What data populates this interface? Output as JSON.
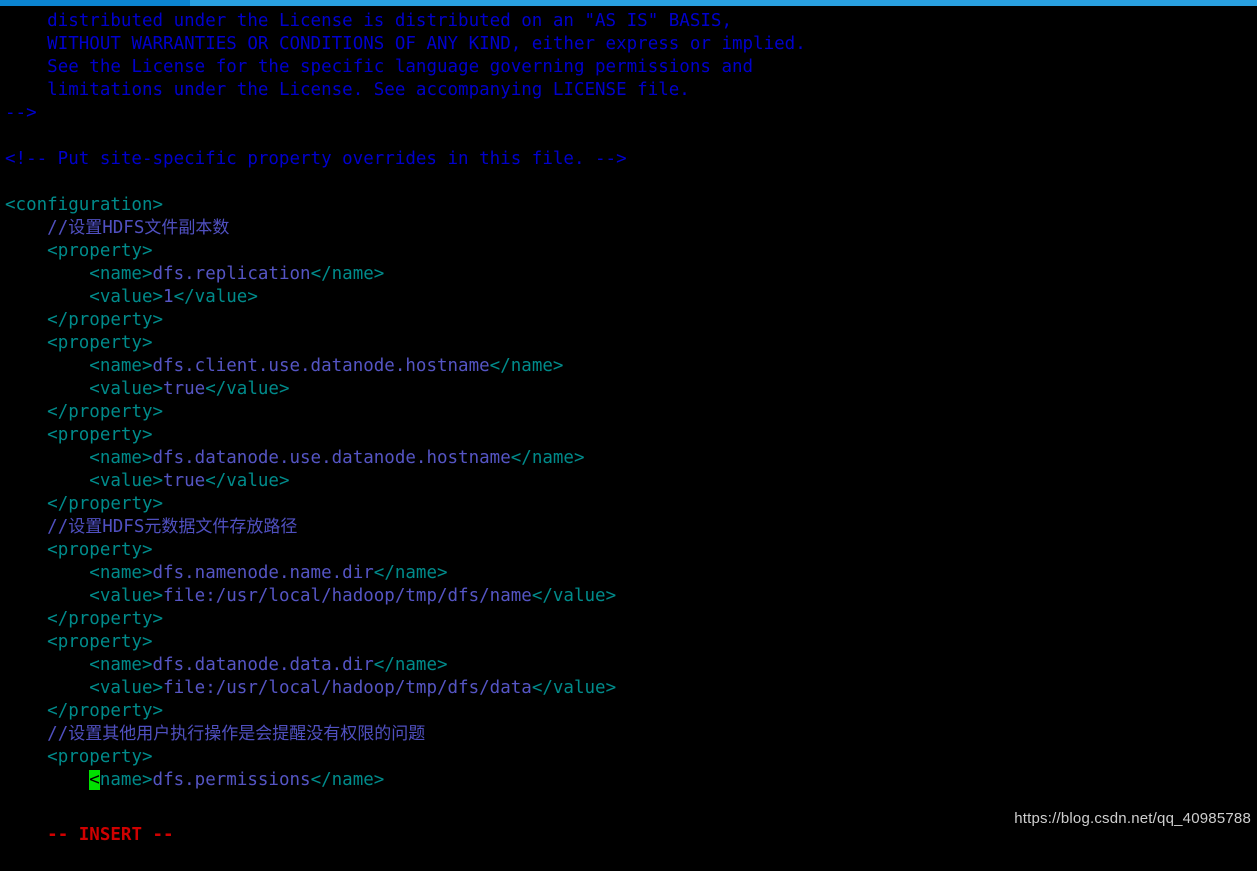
{
  "window": {
    "titlebar_accent": "#0b84d0",
    "titlebar_bg": "#29a0e0"
  },
  "terminal": {
    "background": "#000000",
    "mode_label": "-- INSERT --",
    "mode_color": "#d00000",
    "cursor_color": "#00e000",
    "cursor_char": "<"
  },
  "watermark": {
    "text": "https://blog.csdn.net/qq_40985788"
  },
  "colors": {
    "comment": "#0000cd",
    "tag": "#008b8b",
    "text": "#5555c4",
    "slash_comment": "#5050c0"
  },
  "file": {
    "lines": [
      {
        "n": 1,
        "indent": 1,
        "type": "comment",
        "text": "distributed under the License is distributed on an \"AS IS\" BASIS,"
      },
      {
        "n": 2,
        "indent": 1,
        "type": "comment",
        "text": "WITHOUT WARRANTIES OR CONDITIONS OF ANY KIND, either express or implied."
      },
      {
        "n": 3,
        "indent": 1,
        "type": "comment",
        "text": "See the License for the specific language governing permissions and"
      },
      {
        "n": 4,
        "indent": 1,
        "type": "comment",
        "text": "limitations under the License. See accompanying LICENSE file."
      },
      {
        "n": 5,
        "indent": 0,
        "type": "commark",
        "text": "-->"
      },
      {
        "n": 6,
        "indent": 0,
        "type": "blank",
        "text": ""
      },
      {
        "n": 7,
        "indent": 0,
        "type": "commark",
        "text": "<!-- Put site-specific property overrides in this file. -->"
      },
      {
        "n": 8,
        "indent": 0,
        "type": "blank",
        "text": ""
      },
      {
        "n": 9,
        "indent": 0,
        "type": "tag",
        "text": "<configuration>"
      },
      {
        "n": 10,
        "indent": 1,
        "type": "slashcom",
        "text": "//设置HDFS文件副本数"
      },
      {
        "n": 11,
        "indent": 1,
        "type": "tag",
        "text": "<property>"
      },
      {
        "n": 12,
        "indent": 2,
        "type": "element",
        "open": "<name>",
        "value": "dfs.replication",
        "close": "</name>"
      },
      {
        "n": 13,
        "indent": 2,
        "type": "element",
        "open": "<value>",
        "value": "1",
        "close": "</value>"
      },
      {
        "n": 14,
        "indent": 1,
        "type": "tag",
        "text": "</property>"
      },
      {
        "n": 15,
        "indent": 1,
        "type": "tag",
        "text": "<property>"
      },
      {
        "n": 16,
        "indent": 2,
        "type": "element",
        "open": "<name>",
        "value": "dfs.client.use.datanode.hostname",
        "close": "</name>"
      },
      {
        "n": 17,
        "indent": 2,
        "type": "element",
        "open": "<value>",
        "value": "true",
        "close": "</value>"
      },
      {
        "n": 18,
        "indent": 1,
        "type": "tag",
        "text": "</property>"
      },
      {
        "n": 19,
        "indent": 1,
        "type": "tag",
        "text": "<property>"
      },
      {
        "n": 20,
        "indent": 2,
        "type": "element",
        "open": "<name>",
        "value": "dfs.datanode.use.datanode.hostname",
        "close": "</name>"
      },
      {
        "n": 21,
        "indent": 2,
        "type": "element",
        "open": "<value>",
        "value": "true",
        "close": "</value>"
      },
      {
        "n": 22,
        "indent": 1,
        "type": "tag",
        "text": "</property>"
      },
      {
        "n": 23,
        "indent": 1,
        "type": "slashcom",
        "text": "//设置HDFS元数据文件存放路径"
      },
      {
        "n": 24,
        "indent": 1,
        "type": "tag",
        "text": "<property>"
      },
      {
        "n": 25,
        "indent": 2,
        "type": "element",
        "open": "<name>",
        "value": "dfs.namenode.name.dir",
        "close": "</name>"
      },
      {
        "n": 26,
        "indent": 2,
        "type": "element",
        "open": "<value>",
        "value": "file:/usr/local/hadoop/tmp/dfs/name",
        "close": "</value>"
      },
      {
        "n": 27,
        "indent": 1,
        "type": "tag",
        "text": "</property>"
      },
      {
        "n": 28,
        "indent": 1,
        "type": "tag",
        "text": "<property>"
      },
      {
        "n": 29,
        "indent": 2,
        "type": "element",
        "open": "<name>",
        "value": "dfs.datanode.data.dir",
        "close": "</name>"
      },
      {
        "n": 30,
        "indent": 2,
        "type": "element",
        "open": "<value>",
        "value": "file:/usr/local/hadoop/tmp/dfs/data",
        "close": "</value>"
      },
      {
        "n": 31,
        "indent": 1,
        "type": "tag",
        "text": "</property>"
      },
      {
        "n": 32,
        "indent": 1,
        "type": "slashcom",
        "text": "//设置其他用户执行操作是会提醒没有权限的问题"
      },
      {
        "n": 33,
        "indent": 1,
        "type": "tag",
        "text": "<property>"
      },
      {
        "n": 34,
        "indent": 2,
        "type": "element",
        "open": "<name>",
        "value": "dfs.permissions",
        "close": "</name>",
        "cursor": true
      }
    ]
  }
}
